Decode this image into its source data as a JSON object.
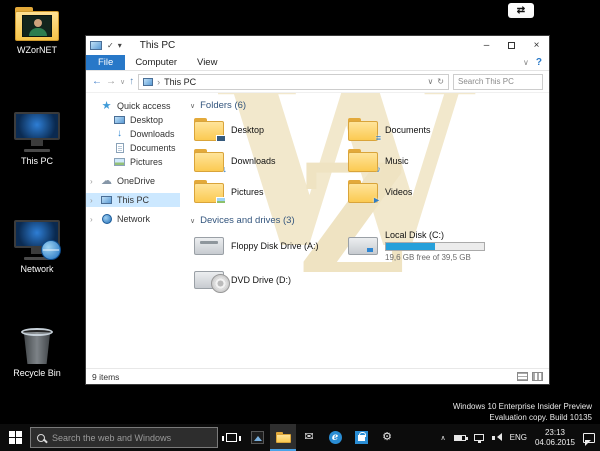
{
  "glyphs": {
    "top_arrows": "⇄",
    "back": "←",
    "forward": "→",
    "small_chevron_down": "∨",
    "up": "↑",
    "crumb_sep": "›",
    "address_refresh": "↻",
    "ribbon_chevron": "∨",
    "help": "?",
    "minimize": "–",
    "close": "×",
    "qat_check": "✓",
    "qat_dropdown": "▾",
    "tree_chevron": "›",
    "star": "★",
    "cloud": "☁",
    "down_arrow": "↓",
    "section_chevron": "∨",
    "hidden_icons": "∧",
    "music_note": "♪",
    "docs_lines": "≡",
    "video_play": "►",
    "edge_e": "e",
    "mail": "✉",
    "gear": "⚙"
  },
  "desktop": {
    "icons": [
      {
        "label": "WZorNET"
      },
      {
        "label": "This PC"
      },
      {
        "label": "Network"
      },
      {
        "label": "Recycle Bin"
      }
    ],
    "build_info": {
      "line1": "Windows 10 Enterprise Insider Preview",
      "line2": "Evaluation copy. Build 10135"
    }
  },
  "watermark": {
    "letter_w": "W",
    "letter_z": "Z"
  },
  "explorer": {
    "title": "This PC",
    "tabs": {
      "file": "File",
      "computer": "Computer",
      "view": "View"
    },
    "address": {
      "location": "This PC",
      "search_placeholder": "Search This PC"
    },
    "sidebar": [
      {
        "label": "Quick access"
      },
      {
        "label": "Desktop"
      },
      {
        "label": "Downloads"
      },
      {
        "label": "Documents"
      },
      {
        "label": "Pictures"
      },
      {
        "label": "OneDrive"
      },
      {
        "label": "This PC"
      },
      {
        "label": "Network"
      }
    ],
    "sections": {
      "folders": {
        "header": "Folders (6)",
        "items": [
          "Desktop",
          "Documents",
          "Downloads",
          "Music",
          "Pictures",
          "Videos"
        ]
      },
      "devices": {
        "header": "Devices and drives (3)",
        "floppy": {
          "name": "Floppy Disk Drive (A:)"
        },
        "disk_c": {
          "name": "Local Disk (C:)",
          "free_text": "19,6 GB free of 39,5 GB",
          "used_percent": 50
        },
        "dvd": {
          "name": "DVD Drive (D:)"
        }
      }
    },
    "status": {
      "items_count": "9 items"
    }
  },
  "taskbar": {
    "search_placeholder": "Search the web and Windows",
    "tray": {
      "language": "ENG",
      "time": "23:13",
      "date": "04.06.2015"
    }
  }
}
